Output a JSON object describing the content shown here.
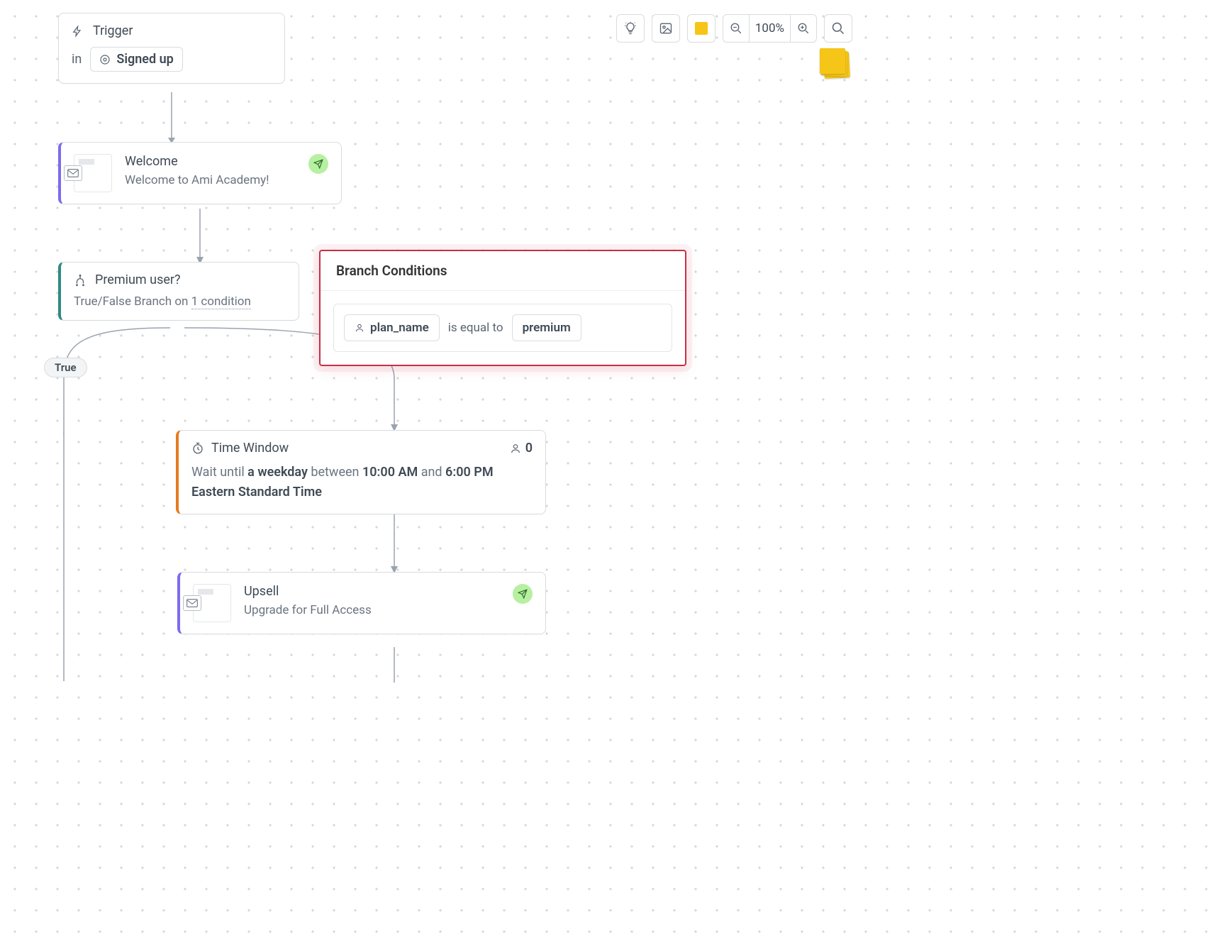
{
  "toolbar": {
    "zoom_label": "100%"
  },
  "trigger": {
    "title": "Trigger",
    "in_label": "in",
    "event": "Signed up"
  },
  "welcome": {
    "title": "Welcome",
    "subtitle": "Welcome to Ami Academy!"
  },
  "branch": {
    "title": "Premium user?",
    "desc_prefix": "True/False Branch on ",
    "condition_count": "1 condition"
  },
  "branch_popup": {
    "header": "Branch Conditions",
    "attr": "plan_name",
    "op": "is equal to",
    "value": "premium"
  },
  "labels": {
    "true": "True"
  },
  "timewin": {
    "title": "Time Window",
    "count": "0",
    "p1": "Wait until ",
    "b1": "a weekday",
    "p2": " between ",
    "b2": "10:00 AM",
    "p3": " and ",
    "b3": "6:00 PM Eastern Standard Time"
  },
  "upsell": {
    "title": "Upsell",
    "subtitle": "Upgrade for Full Access"
  }
}
